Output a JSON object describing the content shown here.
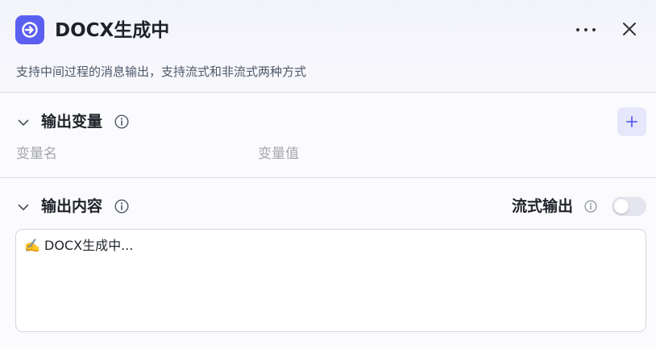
{
  "node": {
    "title": "DOCX生成中",
    "description": "支持中间过程的消息输出，支持流式和非流式两种方式",
    "icon": "output-node-icon",
    "accent": "#5a5ff0"
  },
  "output_variables": {
    "title": "输出变量",
    "columns": [
      "变量名",
      "变量值"
    ],
    "add_icon": "plus-icon"
  },
  "output_content": {
    "title": "输出内容",
    "streaming_label": "流式输出",
    "streaming_enabled": false,
    "emoji": "✍️",
    "content": "DOCX生成中..."
  }
}
